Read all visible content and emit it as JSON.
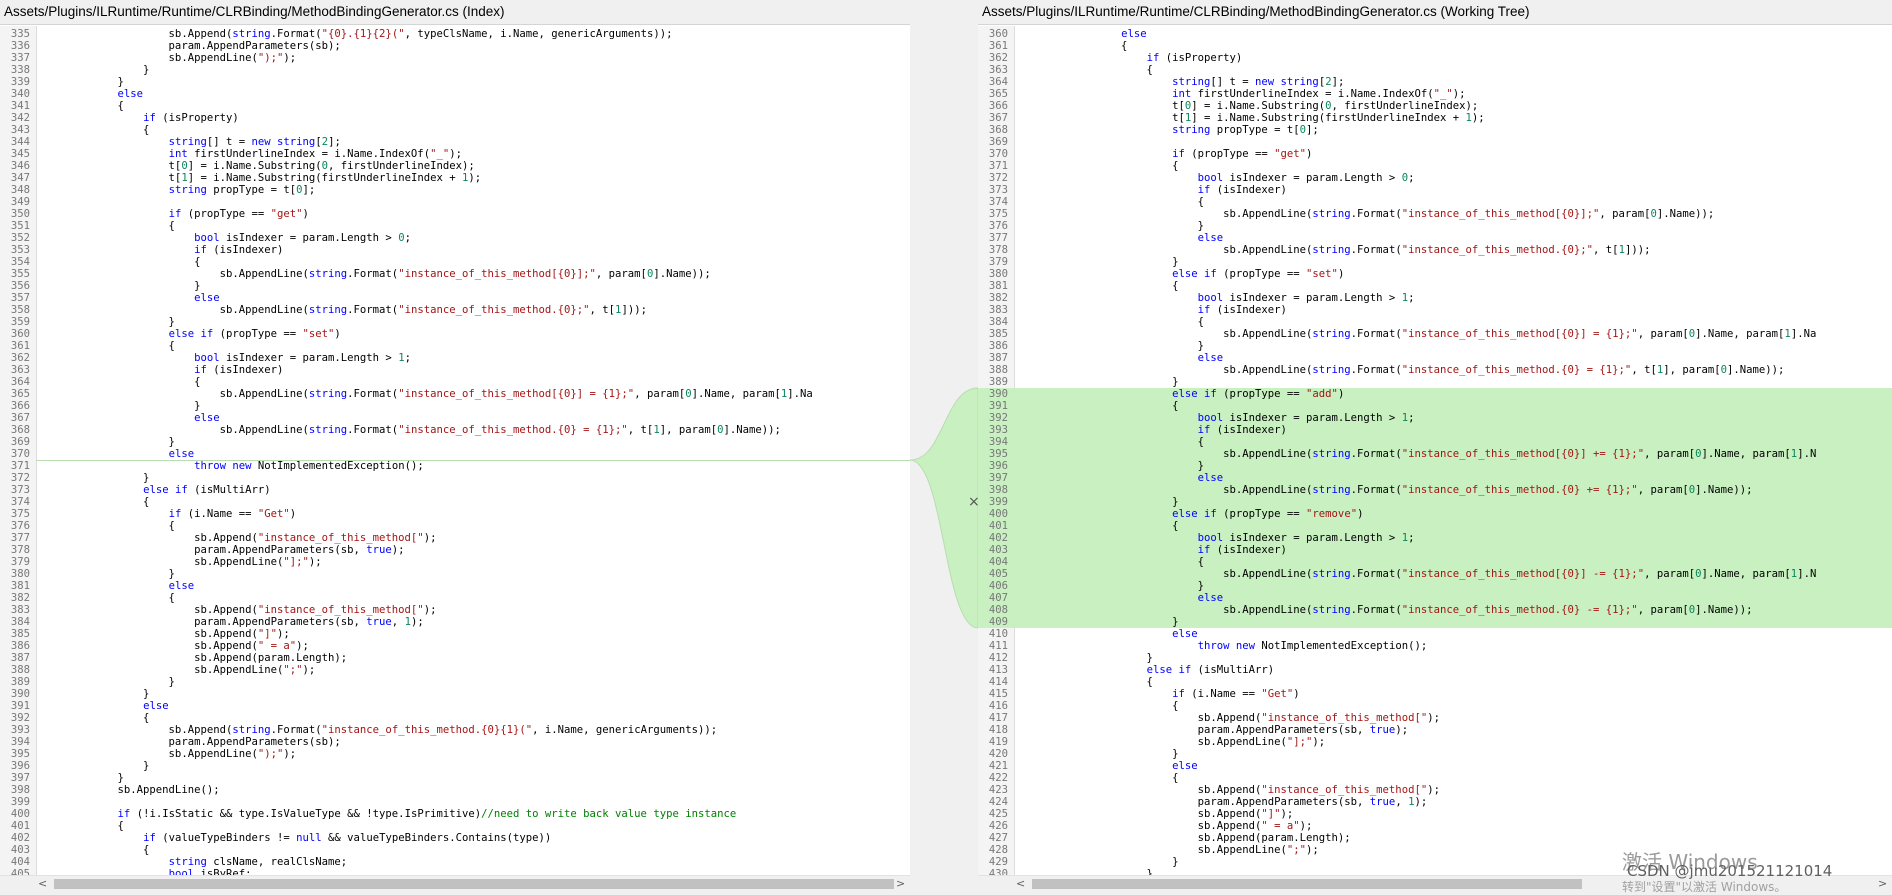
{
  "left": {
    "title": "Assets/Plugins/ILRuntime/Runtime/CLRBinding/MethodBindingGenerator.cs (Index)",
    "lines": [
      [
        335,
        "                    sb.Append(string.Format(\"{0}.{1}{2}(\", typeClsName, i.Name, genericArguments));"
      ],
      [
        336,
        "                    param.AppendParameters(sb);"
      ],
      [
        337,
        "                    sb.AppendLine(\");\");"
      ],
      [
        338,
        "                }"
      ],
      [
        339,
        "            }"
      ],
      [
        340,
        "            else"
      ],
      [
        341,
        "            {"
      ],
      [
        342,
        "                if (isProperty)"
      ],
      [
        343,
        "                {"
      ],
      [
        344,
        "                    string[] t = new string[2];"
      ],
      [
        345,
        "                    int firstUnderlineIndex = i.Name.IndexOf(\"_\");"
      ],
      [
        346,
        "                    t[0] = i.Name.Substring(0, firstUnderlineIndex);"
      ],
      [
        347,
        "                    t[1] = i.Name.Substring(firstUnderlineIndex + 1);"
      ],
      [
        348,
        "                    string propType = t[0];"
      ],
      [
        349,
        ""
      ],
      [
        350,
        "                    if (propType == \"get\")"
      ],
      [
        351,
        "                    {"
      ],
      [
        352,
        "                        bool isIndexer = param.Length > 0;"
      ],
      [
        353,
        "                        if (isIndexer)"
      ],
      [
        354,
        "                        {"
      ],
      [
        355,
        "                            sb.AppendLine(string.Format(\"instance_of_this_method[{0}];\", param[0].Name));"
      ],
      [
        356,
        "                        }"
      ],
      [
        357,
        "                        else"
      ],
      [
        358,
        "                            sb.AppendLine(string.Format(\"instance_of_this_method.{0};\", t[1]));"
      ],
      [
        359,
        "                    }"
      ],
      [
        360,
        "                    else if (propType == \"set\")"
      ],
      [
        361,
        "                    {"
      ],
      [
        362,
        "                        bool isIndexer = param.Length > 1;"
      ],
      [
        363,
        "                        if (isIndexer)"
      ],
      [
        364,
        "                        {"
      ],
      [
        365,
        "                            sb.AppendLine(string.Format(\"instance_of_this_method[{0}] = {1};\", param[0].Name, param[1].Na"
      ],
      [
        366,
        "                        }"
      ],
      [
        367,
        "                        else"
      ],
      [
        368,
        "                            sb.AppendLine(string.Format(\"instance_of_this_method.{0} = {1};\", t[1], param[0].Name));"
      ],
      [
        369,
        "                    }"
      ],
      [
        370,
        "                    else"
      ],
      [
        371,
        "                        throw new NotImplementedException();"
      ],
      [
        372,
        "                }"
      ],
      [
        373,
        "                else if (isMultiArr)"
      ],
      [
        374,
        "                {"
      ],
      [
        375,
        "                    if (i.Name == \"Get\")"
      ],
      [
        376,
        "                    {"
      ],
      [
        377,
        "                        sb.Append(\"instance_of_this_method[\");"
      ],
      [
        378,
        "                        param.AppendParameters(sb, true);"
      ],
      [
        379,
        "                        sb.AppendLine(\"];\");"
      ],
      [
        380,
        "                    }"
      ],
      [
        381,
        "                    else"
      ],
      [
        382,
        "                    {"
      ],
      [
        383,
        "                        sb.Append(\"instance_of_this_method[\");"
      ],
      [
        384,
        "                        param.AppendParameters(sb, true, 1);"
      ],
      [
        385,
        "                        sb.Append(\"]\");"
      ],
      [
        386,
        "                        sb.Append(\" = a\");"
      ],
      [
        387,
        "                        sb.Append(param.Length);"
      ],
      [
        388,
        "                        sb.AppendLine(\";\");"
      ],
      [
        389,
        "                    }"
      ],
      [
        390,
        "                }"
      ],
      [
        391,
        "                else"
      ],
      [
        392,
        "                {"
      ],
      [
        393,
        "                    sb.Append(string.Format(\"instance_of_this_method.{0}{1}(\", i.Name, genericArguments));"
      ],
      [
        394,
        "                    param.AppendParameters(sb);"
      ],
      [
        395,
        "                    sb.AppendLine(\");\");"
      ],
      [
        396,
        "                }"
      ],
      [
        397,
        "            }"
      ],
      [
        398,
        "            sb.AppendLine();"
      ],
      [
        399,
        ""
      ],
      [
        400,
        "            if (!i.IsStatic && type.IsValueType && !type.IsPrimitive)//need to write back value type instance"
      ],
      [
        401,
        "            {"
      ],
      [
        402,
        "                if (valueTypeBinders != null && valueTypeBinders.Contains(type))"
      ],
      [
        403,
        "                {"
      ],
      [
        404,
        "                    string clsName, realClsName;"
      ],
      [
        405,
        "                    bool isByRef;"
      ]
    ]
  },
  "right": {
    "title": "Assets/Plugins/ILRuntime/Runtime/CLRBinding/MethodBindingGenerator.cs (Working Tree)",
    "lines": [
      [
        360,
        "                else"
      ],
      [
        361,
        "                {"
      ],
      [
        362,
        "                    if (isProperty)"
      ],
      [
        363,
        "                    {"
      ],
      [
        364,
        "                        string[] t = new string[2];"
      ],
      [
        365,
        "                        int firstUnderlineIndex = i.Name.IndexOf(\"_\");"
      ],
      [
        366,
        "                        t[0] = i.Name.Substring(0, firstUnderlineIndex);"
      ],
      [
        367,
        "                        t[1] = i.Name.Substring(firstUnderlineIndex + 1);"
      ],
      [
        368,
        "                        string propType = t[0];"
      ],
      [
        369,
        ""
      ],
      [
        370,
        "                        if (propType == \"get\")"
      ],
      [
        371,
        "                        {"
      ],
      [
        372,
        "                            bool isIndexer = param.Length > 0;"
      ],
      [
        373,
        "                            if (isIndexer)"
      ],
      [
        374,
        "                            {"
      ],
      [
        375,
        "                                sb.AppendLine(string.Format(\"instance_of_this_method[{0}];\", param[0].Name));"
      ],
      [
        376,
        "                            }"
      ],
      [
        377,
        "                            else"
      ],
      [
        378,
        "                                sb.AppendLine(string.Format(\"instance_of_this_method.{0};\", t[1]));"
      ],
      [
        379,
        "                        }"
      ],
      [
        380,
        "                        else if (propType == \"set\")"
      ],
      [
        381,
        "                        {"
      ],
      [
        382,
        "                            bool isIndexer = param.Length > 1;"
      ],
      [
        383,
        "                            if (isIndexer)"
      ],
      [
        384,
        "                            {"
      ],
      [
        385,
        "                                sb.AppendLine(string.Format(\"instance_of_this_method[{0}] = {1};\", param[0].Name, param[1].Na"
      ],
      [
        386,
        "                            }"
      ],
      [
        387,
        "                            else"
      ],
      [
        388,
        "                                sb.AppendLine(string.Format(\"instance_of_this_method.{0} = {1};\", t[1], param[0].Name));"
      ],
      [
        389,
        "                        }"
      ],
      [
        390,
        "                        else if (propType == \"add\")"
      ],
      [
        391,
        "                        {"
      ],
      [
        392,
        "                            bool isIndexer = param.Length > 1;"
      ],
      [
        393,
        "                            if (isIndexer)"
      ],
      [
        394,
        "                            {"
      ],
      [
        395,
        "                                sb.AppendLine(string.Format(\"instance_of_this_method[{0}] += {1};\", param[0].Name, param[1].N"
      ],
      [
        396,
        "                            }"
      ],
      [
        397,
        "                            else"
      ],
      [
        398,
        "                                sb.AppendLine(string.Format(\"instance_of_this_method.{0} += {1};\", param[0].Name));"
      ],
      [
        399,
        "                        }"
      ],
      [
        400,
        "                        else if (propType == \"remove\")"
      ],
      [
        401,
        "                        {"
      ],
      [
        402,
        "                            bool isIndexer = param.Length > 1;"
      ],
      [
        403,
        "                            if (isIndexer)"
      ],
      [
        404,
        "                            {"
      ],
      [
        405,
        "                                sb.AppendLine(string.Format(\"instance_of_this_method[{0}] -= {1};\", param[0].Name, param[1].N"
      ],
      [
        406,
        "                            }"
      ],
      [
        407,
        "                            else"
      ],
      [
        408,
        "                                sb.AppendLine(string.Format(\"instance_of_this_method.{0} -= {1};\", param[0].Name));"
      ],
      [
        409,
        "                        }"
      ],
      [
        410,
        "                        else"
      ],
      [
        411,
        "                            throw new NotImplementedException();"
      ],
      [
        412,
        "                    }"
      ],
      [
        413,
        "                    else if (isMultiArr)"
      ],
      [
        414,
        "                    {"
      ],
      [
        415,
        "                        if (i.Name == \"Get\")"
      ],
      [
        416,
        "                        {"
      ],
      [
        417,
        "                            sb.Append(\"instance_of_this_method[\");"
      ],
      [
        418,
        "                            param.AppendParameters(sb, true);"
      ],
      [
        419,
        "                            sb.AppendLine(\"];\");"
      ],
      [
        420,
        "                        }"
      ],
      [
        421,
        "                        else"
      ],
      [
        422,
        "                        {"
      ],
      [
        423,
        "                            sb.Append(\"instance_of_this_method[\");"
      ],
      [
        424,
        "                            param.AppendParameters(sb, true, 1);"
      ],
      [
        425,
        "                            sb.Append(\"]\");"
      ],
      [
        426,
        "                            sb.Append(\" = a\");"
      ],
      [
        427,
        "                            sb.Append(param.Length);"
      ],
      [
        428,
        "                            sb.AppendLine(\";\");"
      ],
      [
        429,
        "                        }"
      ],
      [
        430,
        "                    }"
      ]
    ],
    "added_from": 390,
    "added_to": 409
  },
  "left_insert_after": 370,
  "colors": {
    "added": "#c8f0c0",
    "connector_stroke": "#b9dcb0"
  },
  "watermark": {
    "activate": "激活 Windows",
    "csdn": "CSDN @jmu201521121014",
    "goto": "转到\"设置\"以激活 Windows。"
  },
  "icons": {
    "close": "close-icon",
    "scroll_left": "arrow-left-icon",
    "scroll_right": "arrow-right-icon"
  }
}
